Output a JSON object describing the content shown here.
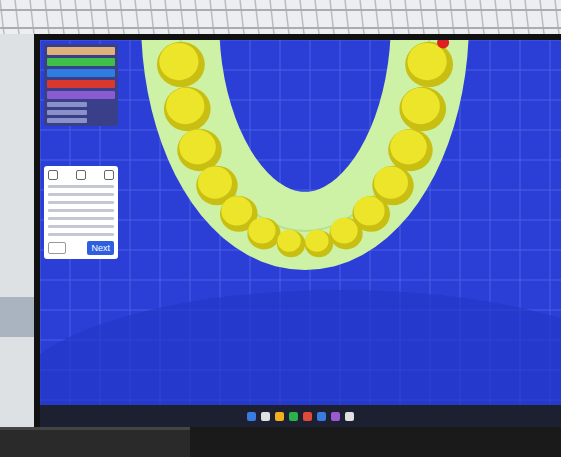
{
  "viewer": {
    "layers": [
      {
        "color": "#e0b27a"
      },
      {
        "color": "#3fbf4a"
      },
      {
        "color": "#2f7de0"
      },
      {
        "color": "#d9382f"
      },
      {
        "color": "#8a5ad0"
      }
    ],
    "tooth_count": 14,
    "margin_marker_color": "#e02020"
  },
  "tool_panel": {
    "buttons": [
      {
        "label": "Next",
        "primary": true
      }
    ]
  }
}
